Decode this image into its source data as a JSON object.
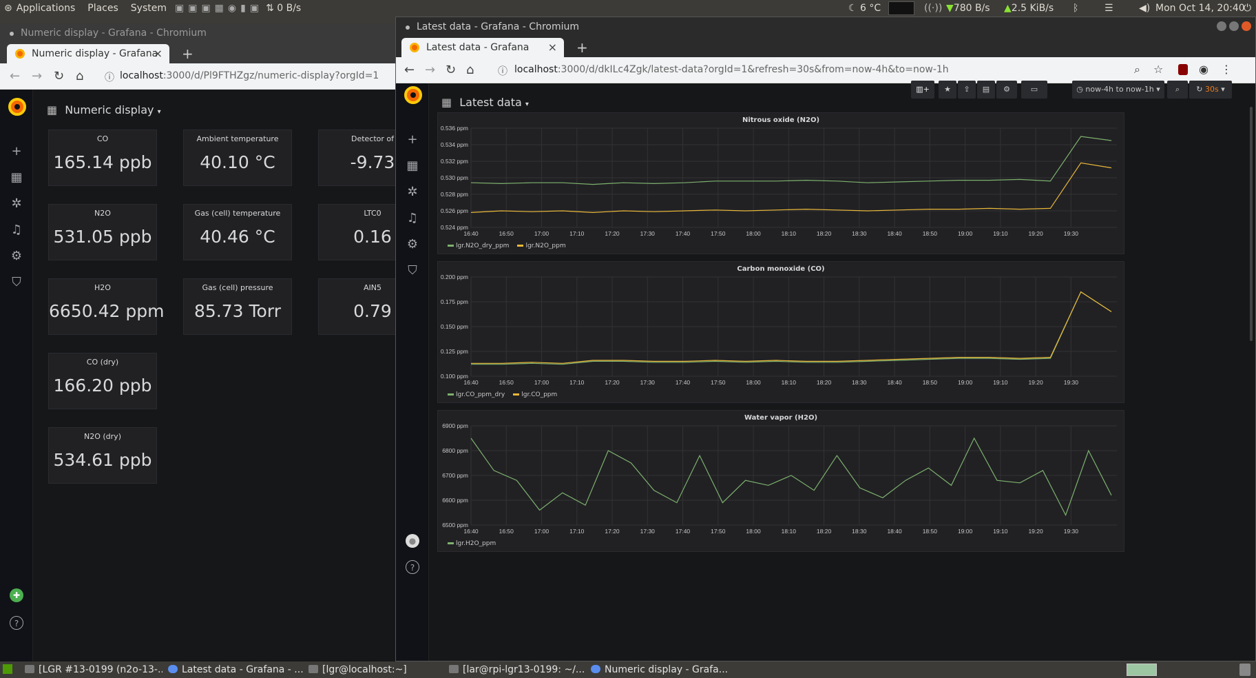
{
  "top_panel": {
    "menus": [
      "Applications",
      "Places",
      "System"
    ],
    "net_left": "0 B/s",
    "weather": "6 °C",
    "down_speed": "780 B/s",
    "up_speed": "2.5 KiB/s",
    "clock": "Mon Oct 14, 20:40"
  },
  "left_window": {
    "title": "Numeric display - Grafana - Chromium",
    "tab_label": "Numeric display - Grafana",
    "url_host": "localhost",
    "url_rest": ":3000/d/Pl9FTHZgz/numeric-display?orgId=1",
    "dashboard_title": "Numeric display",
    "panels": [
      {
        "title": "CO",
        "value": "165.14 ppb"
      },
      {
        "title": "Ambient temperature",
        "value": "40.10 °C"
      },
      {
        "title": "Detector of",
        "value": "-9.73"
      },
      {
        "title": "N2O",
        "value": "531.05 ppb"
      },
      {
        "title": "Gas (cell) temperature",
        "value": "40.46 °C"
      },
      {
        "title": "LTC0",
        "value": "0.16"
      },
      {
        "title": "H2O",
        "value": "6650.42 ppm"
      },
      {
        "title": "Gas (cell) pressure",
        "value": "85.73 Torr"
      },
      {
        "title": "AIN5",
        "value": "0.79"
      },
      {
        "title": "CO (dry)",
        "value": "166.20 ppb"
      },
      {
        "title": "N2O (dry)",
        "value": "534.61 ppb"
      }
    ]
  },
  "right_window": {
    "title": "Latest data - Grafana - Chromium",
    "tab_label": "Latest data - Grafana",
    "url_host": "localhost",
    "url_rest": ":3000/d/dkILc4Zgk/latest-data?orgId=1&refresh=30s&from=now-4h&to=now-1h",
    "dashboard_title": "Latest data",
    "time_range": "now-4h to now-1h",
    "refresh": "30s"
  },
  "chart_data": [
    {
      "type": "line",
      "title": "Nitrous oxide (N2O)",
      "x": [
        "16:40",
        "16:50",
        "17:00",
        "17:10",
        "17:20",
        "17:30",
        "17:40",
        "17:50",
        "18:00",
        "18:10",
        "18:20",
        "18:30",
        "18:40",
        "18:50",
        "19:00",
        "19:10",
        "19:20",
        "19:30"
      ],
      "yticks": [
        "0.524 ppm",
        "0.526 ppm",
        "0.528 ppm",
        "0.530 ppm",
        "0.532 ppm",
        "0.534 ppm",
        "0.536 ppm"
      ],
      "ylim": [
        0.524,
        0.536
      ],
      "series": [
        {
          "name": "lgr.N2O_dry_ppm",
          "color": "#7eb26d",
          "values": [
            0.5294,
            0.5293,
            0.5294,
            0.5294,
            0.5292,
            0.5294,
            0.5293,
            0.5294,
            0.5296,
            0.5296,
            0.5296,
            0.5297,
            0.5296,
            0.5294,
            0.5295,
            0.5296,
            0.5297,
            0.5297,
            0.5298,
            0.5296,
            0.535,
            0.5345
          ]
        },
        {
          "name": "lgr.N2O_ppm",
          "color": "#eab839",
          "values": [
            0.5258,
            0.526,
            0.5259,
            0.526,
            0.5258,
            0.526,
            0.5259,
            0.526,
            0.5261,
            0.526,
            0.5261,
            0.5262,
            0.5261,
            0.526,
            0.5261,
            0.5262,
            0.5262,
            0.5263,
            0.5262,
            0.5263,
            0.5318,
            0.5312
          ]
        }
      ],
      "grid": true,
      "legend": "bottom-left"
    },
    {
      "type": "line",
      "title": "Carbon monoxide (CO)",
      "x": [
        "16:40",
        "16:50",
        "17:00",
        "17:10",
        "17:20",
        "17:30",
        "17:40",
        "17:50",
        "18:00",
        "18:10",
        "18:20",
        "18:30",
        "18:40",
        "18:50",
        "19:00",
        "19:10",
        "19:20",
        "19:30"
      ],
      "yticks": [
        "0.100 ppm",
        "0.125 ppm",
        "0.150 ppm",
        "0.175 ppm",
        "0.200 ppm"
      ],
      "ylim": [
        0.1,
        0.2
      ],
      "series": [
        {
          "name": "lgr.CO_ppm_dry",
          "color": "#7eb26d",
          "values": [
            0.112,
            0.112,
            0.113,
            0.112,
            0.115,
            0.115,
            0.114,
            0.114,
            0.115,
            0.114,
            0.115,
            0.114,
            0.114,
            0.115,
            0.116,
            0.117,
            0.118,
            0.118,
            0.117,
            0.118,
            0.185,
            0.165
          ]
        },
        {
          "name": "lgr.CO_ppm",
          "color": "#eab839",
          "values": [
            0.113,
            0.113,
            0.114,
            0.113,
            0.116,
            0.116,
            0.115,
            0.115,
            0.116,
            0.115,
            0.116,
            0.115,
            0.115,
            0.116,
            0.117,
            0.118,
            0.119,
            0.119,
            0.118,
            0.119,
            0.185,
            0.165
          ]
        }
      ],
      "grid": true,
      "legend": "bottom-left"
    },
    {
      "type": "line",
      "title": "Water vapor (H2O)",
      "x": [
        "16:40",
        "16:50",
        "17:00",
        "17:10",
        "17:20",
        "17:30",
        "17:40",
        "17:50",
        "18:00",
        "18:10",
        "18:20",
        "18:30",
        "18:40",
        "18:50",
        "19:00",
        "19:10",
        "19:20",
        "19:30"
      ],
      "yticks": [
        "6500 ppm",
        "6600 ppm",
        "6700 ppm",
        "6800 ppm",
        "6900 ppm"
      ],
      "ylim": [
        6500,
        6900
      ],
      "series": [
        {
          "name": "lgr.H2O_ppm",
          "color": "#7eb26d",
          "values": [
            6850,
            6720,
            6680,
            6560,
            6630,
            6580,
            6800,
            6750,
            6640,
            6590,
            6780,
            6590,
            6680,
            6660,
            6700,
            6640,
            6780,
            6650,
            6610,
            6680,
            6730,
            6660,
            6850,
            6680,
            6670,
            6720,
            6540,
            6800,
            6620
          ]
        }
      ],
      "grid": true,
      "legend": "bottom-left"
    }
  ],
  "taskbar": {
    "items": [
      "[LGR #13-0199 (n2o-13-...",
      "Latest data - Grafana - ...",
      "[lgr@localhost:~]",
      "[lar@rpi-lgr13-0199: ~/...",
      "Numeric display - Grafa..."
    ]
  }
}
